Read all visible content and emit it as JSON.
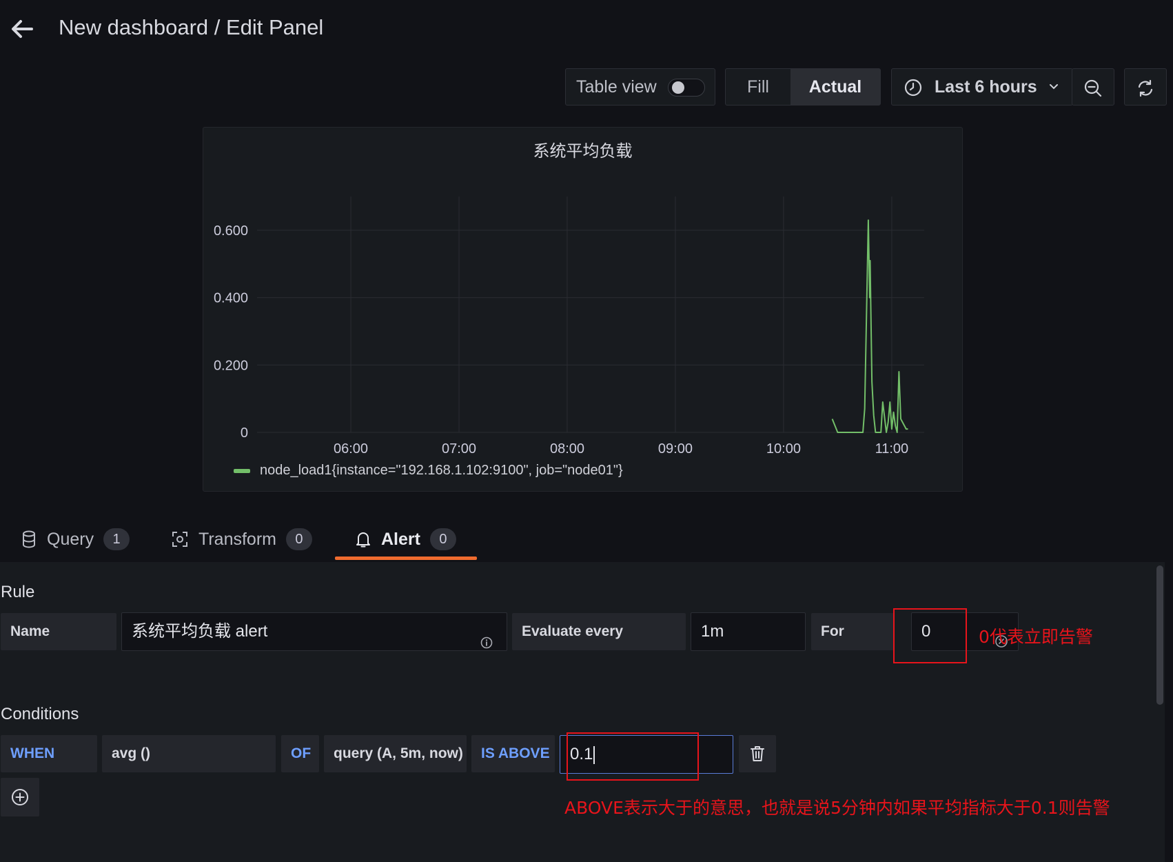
{
  "header": {
    "title": "New dashboard / Edit Panel",
    "back_icon": "arrow-left-icon"
  },
  "toolbar": {
    "table_view_label": "Table view",
    "table_view_on": false,
    "fill_label": "Fill",
    "actual_label": "Actual",
    "actual_selected": true,
    "time_range_label": "Last 6 hours",
    "icons": [
      "clock-icon",
      "chevron-down-icon",
      "zoom-out-icon",
      "refresh-icon"
    ]
  },
  "panel": {
    "title": "系统平均负载",
    "legend": "node_load1{instance=\"192.168.1.102:9100\", job=\"node01\"}",
    "series_color": "#73bf69"
  },
  "chart_data": {
    "type": "line",
    "title": "系统平均负载",
    "xlabel": "",
    "ylabel": "",
    "x_ticks": [
      "06:00",
      "07:00",
      "08:00",
      "09:00",
      "10:00",
      "11:00"
    ],
    "y_ticks": [
      "0",
      "0.200",
      "0.400",
      "0.600"
    ],
    "ylim": [
      0,
      0.7
    ],
    "grid": true,
    "legend_placement": "bottom-left",
    "series": [
      {
        "name": "node_load1{instance=\"192.168.1.102:9100\", job=\"node01\"}",
        "color": "#73bf69",
        "x": [
          "10:27",
          "10:30",
          "10:32",
          "10:40",
          "10:44",
          "10:45",
          "10:46",
          "10:47",
          "10:47",
          "10:48",
          "10:49",
          "10:50",
          "10:51",
          "10:52",
          "10:54",
          "10:55",
          "10:57",
          "10:58",
          "10:59",
          "11:00",
          "11:01",
          "11:02",
          "11:03",
          "11:04",
          "11:05",
          "11:07",
          "11:08",
          "11:09"
        ],
        "values": [
          0.04,
          0,
          0,
          0,
          0,
          0.07,
          0.35,
          0.63,
          0.4,
          0.51,
          0.15,
          0.05,
          0,
          0,
          0,
          0.09,
          0,
          0.03,
          0.09,
          0.01,
          0.06,
          0.02,
          0,
          0.18,
          0.04,
          0.02,
          0.01,
          0.01
        ]
      }
    ]
  },
  "tabs": [
    {
      "label": "Query",
      "count": "1",
      "icon": "database-icon"
    },
    {
      "label": "Transform",
      "count": "0",
      "icon": "transform-icon"
    },
    {
      "label": "Alert",
      "count": "0",
      "icon": "bell-icon",
      "active": true
    }
  ],
  "rule": {
    "section_title": "Rule",
    "name_label": "Name",
    "name_value": "系统平均负载 alert",
    "evaluate_label": "Evaluate every",
    "evaluate_value": "1m",
    "for_label": "For",
    "for_value": "0"
  },
  "conditions": {
    "section_title": "Conditions",
    "when": "WHEN",
    "reducer": "avg ()",
    "of": "OF",
    "query": "query (A, 5m, now)",
    "evaluator": "IS ABOVE",
    "threshold": "0.1"
  },
  "annotations": {
    "for_note": "0代表立即告警",
    "above_note": "ABOVE表示大于的意思，也就是说5分钟内如果平均指标大于0.1则告警",
    "color": "#e8141b"
  },
  "colors": {
    "background": "#111217",
    "panel": "#181b1f",
    "accent_tab": "#f06b2f",
    "keyword_blue": "#6e9fff"
  }
}
